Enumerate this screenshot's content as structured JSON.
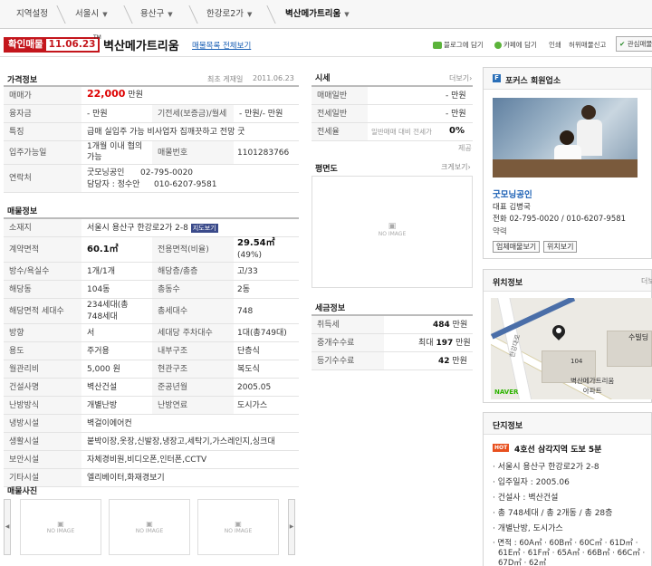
{
  "breadcrumb": {
    "items": [
      "지역설정",
      "서울시",
      "용산구",
      "한강로2가",
      "벽산메가트리움"
    ]
  },
  "header": {
    "badge_label": "확인매물",
    "badge_date": "11.06.23",
    "tm": "TM",
    "title": "벽산메가트리움",
    "links": "매물목록 전체보기",
    "actions": [
      "블로그에 담기",
      "카페에 담기",
      "인쇄",
      "허위매물신고",
      "관심매물"
    ]
  },
  "price_info": {
    "section_title": "가격정보",
    "date_label": "최초 게재일",
    "date_value": "2011.06.23",
    "rows": {
      "price_label": "매매가",
      "price_value": "22,000",
      "price_unit": "만원",
      "loan_label": "융자금",
      "loan_value": "- 만원",
      "deposit_label": "기전세(보증금)/월세",
      "deposit_value": "- 만원/- 만원",
      "feature_label": "특징",
      "feature_value": "급매 실입주 가능 비사업자 집깨끗하고 전망 굿",
      "move_label": "입주가능일",
      "move_value_1": "1개월 이내 협의",
      "move_value_2": "가능",
      "listing_no_label": "매물번호",
      "listing_no_value": "1101283766",
      "contact_label": "연락처",
      "contact_office": "굿모닝공인",
      "contact_office_phone": "02-795-0020",
      "contact_agent": "담당자 : 정수안",
      "contact_agent_phone": "010-6207-9581"
    }
  },
  "listing_info": {
    "section_title": "매물정보",
    "address_label": "소재지",
    "address_value": "서울시 용산구 한강로2가 2-8",
    "map_btn": "지도보기",
    "contract_label": "계약면적",
    "contract_value": "60.1㎡",
    "exclusive_label": "전용면적(비율)",
    "exclusive_value_1": "29.54㎡",
    "exclusive_value_2": "(49%)",
    "rooms_label": "방수/욕실수",
    "rooms_value": "1개/1개",
    "floor_label": "해당층/총층",
    "floor_value": "고/33",
    "dong_label": "해당동",
    "dong_value": "104동",
    "total_dong_label": "총동수",
    "total_dong_value": "2동",
    "area_households_label": "해당면적 세대수",
    "area_households_1": "234세대(총",
    "area_households_2": "748세대",
    "total_households_label": "총세대수",
    "total_households_value": "748",
    "direction_label": "방향",
    "direction_value": "서",
    "parking_label": "세대당 주차대수",
    "parking_value": "1대(총749대)",
    "use_label": "용도",
    "use_value": "주거용",
    "inner_label": "내부구조",
    "inner_value": "단층식",
    "mgmt_label": "월관리비",
    "mgmt_value": "5,000 원",
    "entry_label": "현관구조",
    "entry_value": "복도식",
    "builder_label": "건설사명",
    "builder_value": "벽산건설",
    "built_label": "준공년월",
    "built_value": "2005.05",
    "heat_label": "난방방식",
    "heat_value": "개별난방",
    "fuel_label": "난방연료",
    "fuel_value": "도시가스",
    "cool_label": "냉방시설",
    "cool_value": "벽걸이에어컨",
    "life_label": "생활시설",
    "life_value": "붙박이장,옷장,신발장,냉장고,세탁기,가스레인지,싱크대",
    "security_label": "보안시설",
    "security_value": "자체경비원,비디오폰,인터폰,CCTV",
    "etc_label": "기타시설",
    "etc_value": "엘리베이터,화재경보기"
  },
  "photos": {
    "section_title": "매물사진",
    "no_image": "NO IMAGE"
  },
  "market": {
    "section_title": "시세",
    "more": "더보기",
    "sale_avg_label": "매매일반",
    "sale_avg_value": "- 만원",
    "jeonse_avg_label": "전세일반",
    "jeonse_avg_value": "- 만원",
    "ratio_label": "전세율",
    "ratio_desc": "일반매매 대비 전세가",
    "ratio_value": "0%",
    "provider": "제공"
  },
  "floorplan": {
    "section_title": "평면도",
    "more": "크게보기",
    "no_image": "NO IMAGE"
  },
  "tax": {
    "section_title": "세금정보",
    "acq_label": "취득세",
    "acq_value": "484",
    "acq_unit": "만원",
    "fee_label": "중개수수료",
    "fee_prefix": "최대",
    "fee_value": "197",
    "fee_unit": "만원",
    "reg_label": "등기수수료",
    "reg_value": "42",
    "reg_unit": "만원"
  },
  "agency": {
    "title": "포커스 회원업소",
    "name": "굿모닝공인",
    "rep": "대표 김병국",
    "phone": "전화 02-795-0020 / 010-6207-9581",
    "map_link": "약력",
    "btn_listings": "업체매물보기",
    "btn_location": "위치보기"
  },
  "location": {
    "title": "위치정보",
    "more": "더보",
    "marker_label": "벽산메가트리움",
    "marker_label_2": "아파트",
    "marker_num": "104",
    "station": "수빌딩",
    "road": "한강대로",
    "provider": "NAVER"
  },
  "complex": {
    "title": "단지정보",
    "hot": "HOT",
    "headline": "4호선 삼각지역 도보 5분",
    "items": [
      "서울시 용산구 한강로2가 2-8",
      "입주일자 : 2005.06",
      "건설사 : 벽산건설",
      "총 748세대 / 총 2개동 / 총 28층",
      "개별난방, 도시가스"
    ],
    "area_label": "면적 : 60A㎡ · 60B㎡ · 60C㎡ · 61D㎡ ·",
    "area_line2": "61E㎡ · 61F㎡ · 65A㎡ · 66B㎡ · 66C㎡ ·",
    "area_line3": "67D㎡ · 62㎡"
  }
}
